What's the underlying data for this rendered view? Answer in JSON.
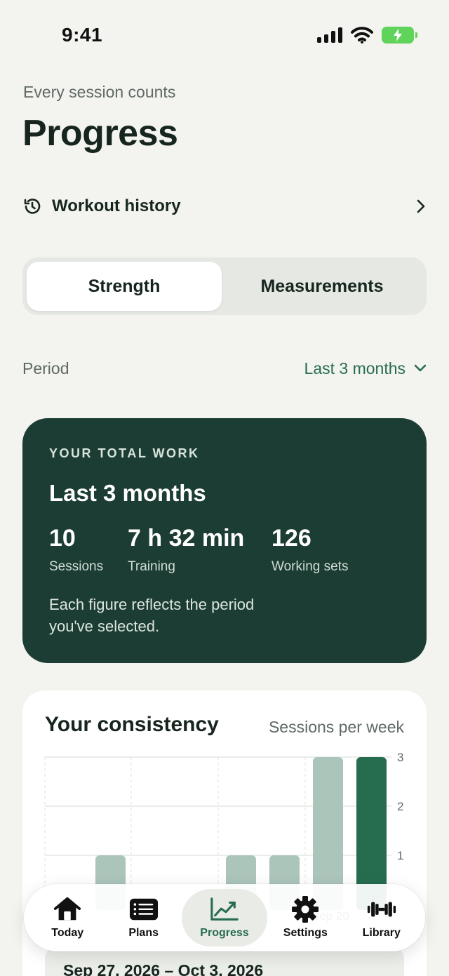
{
  "status_bar": {
    "time": "9:41"
  },
  "header": {
    "subtitle": "Every session counts",
    "title": "Progress"
  },
  "history": {
    "label": "Workout history"
  },
  "segmented": {
    "options": [
      "Strength",
      "Measurements"
    ],
    "selected": "Strength"
  },
  "period": {
    "label": "Period",
    "value": "Last 3 months"
  },
  "work_card": {
    "eyebrow": "YOUR TOTAL WORK",
    "period": "Last 3 months",
    "stats": [
      {
        "value": "10",
        "label": "Sessions"
      },
      {
        "value": "7 h 32 min",
        "label": "Training"
      },
      {
        "value": "126",
        "label": "Working sets"
      }
    ],
    "note": "Each figure reflects the period you've selected."
  },
  "consistency": {
    "title": "Your consistency",
    "subtitle": "Sessions per week",
    "selected_range": "Sep 27, 2026 – Oct 3, 2026"
  },
  "chart_data": {
    "type": "bar",
    "ylabel": "Sessions per week",
    "ylim": [
      0,
      3
    ],
    "y_ticks": [
      "3",
      "2",
      "1"
    ],
    "values": [
      0,
      1,
      0,
      0,
      1,
      1,
      3,
      3
    ],
    "highlighted_index": 7,
    "visible_x_label": "Sep 20",
    "colors": {
      "bar": "#acc5ba",
      "highlight": "#266d4f",
      "grid": "#e4e7e4"
    }
  },
  "tab_bar": {
    "items": [
      {
        "label": "Today",
        "icon": "home-icon"
      },
      {
        "label": "Plans",
        "icon": "list-icon"
      },
      {
        "label": "Progress",
        "icon": "chart-icon",
        "active": true
      },
      {
        "label": "Settings",
        "icon": "gear-icon"
      },
      {
        "label": "Library",
        "icon": "dumbbell-icon"
      }
    ]
  }
}
